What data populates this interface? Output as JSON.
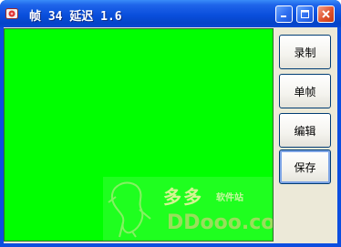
{
  "window": {
    "title": "帧 34 延迟 1.6"
  },
  "buttons": {
    "record": "录制",
    "single_frame": "单帧",
    "edit": "编辑",
    "save": "保存"
  },
  "watermark": {
    "brand": "多多",
    "tag": "软件站",
    "url": "DDooo.com"
  },
  "colors": {
    "canvas": "#00ff00",
    "titlebar": "#0a4fdc",
    "client": "#ece9d8"
  }
}
